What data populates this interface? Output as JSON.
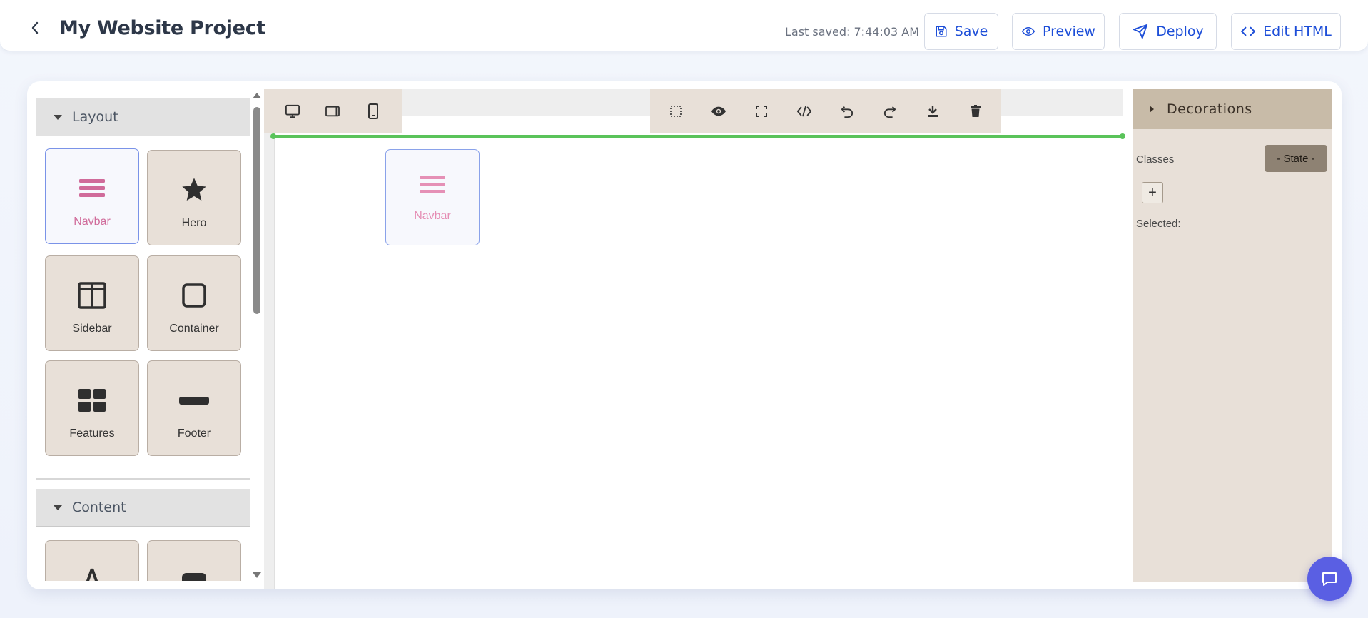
{
  "header": {
    "title": "My Website Project",
    "last_saved": "Last saved: 7:44:03 AM",
    "save_label": "Save",
    "preview_label": "Preview",
    "deploy_label": "Deploy",
    "edit_html_label": "Edit HTML",
    "accent": "#1d4ed8"
  },
  "blocks_panel": {
    "categories": [
      {
        "label": "Layout",
        "blocks": [
          {
            "label": "Navbar",
            "icon": "menu-lines-icon"
          },
          {
            "label": "Hero",
            "icon": "star-icon"
          },
          {
            "label": "Sidebar",
            "icon": "columns-icon"
          },
          {
            "label": "Container",
            "icon": "square-icon"
          },
          {
            "label": "Features",
            "icon": "grid-icon"
          },
          {
            "label": "Footer",
            "icon": "bar-icon"
          }
        ]
      },
      {
        "label": "Content",
        "blocks": [
          {
            "label": "",
            "icon": "text-icon"
          },
          {
            "label": "",
            "icon": "image-icon"
          }
        ]
      }
    ]
  },
  "device_bar": [
    "desktop-icon",
    "tablet-icon",
    "mobile-icon"
  ],
  "toolbar": [
    "outline-icon",
    "eye-icon",
    "fullscreen-icon",
    "code-icon",
    "undo-icon",
    "redo-icon",
    "download-icon",
    "trash-icon"
  ],
  "canvas": {
    "dropped_block_label": "Navbar",
    "indicator_color": "#5ac35a"
  },
  "style_panel": {
    "section_title": "Decorations",
    "classes_label": "Classes",
    "state_label": "- State -",
    "add_label": "+",
    "selected_label": "Selected:"
  },
  "chat": {
    "icon": "chat-icon",
    "color": "#5a5fe3"
  }
}
